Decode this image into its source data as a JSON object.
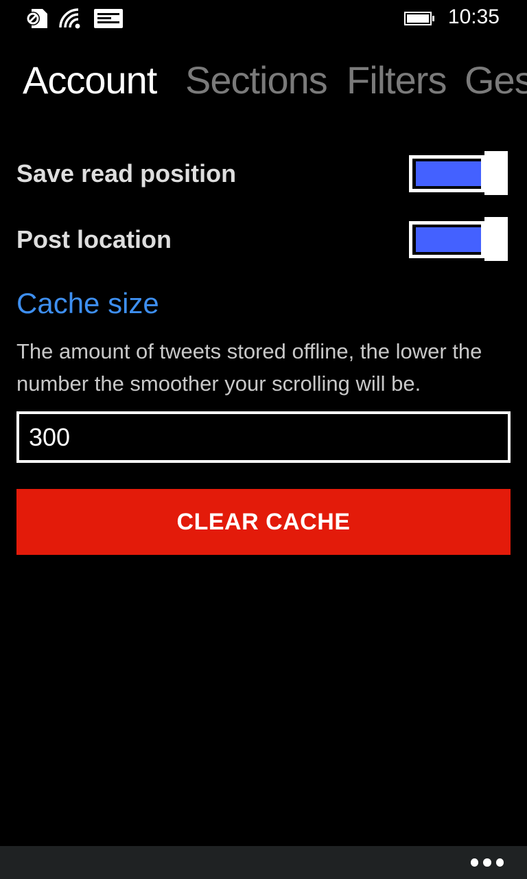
{
  "status_bar": {
    "time": "10:35",
    "icons": [
      "sim-blocked-icon",
      "wifi-icon",
      "notification-icon",
      "battery-icon"
    ]
  },
  "pivot": {
    "tabs": [
      {
        "label": "Account",
        "active": true
      },
      {
        "label": "Sections",
        "active": false
      },
      {
        "label": "Filters",
        "active": false
      },
      {
        "label": "Ges",
        "active": false
      }
    ]
  },
  "settings": {
    "save_read_position": {
      "label": "Save read position",
      "enabled": true
    },
    "post_location": {
      "label": "Post location",
      "enabled": true
    }
  },
  "cache": {
    "title": "Cache size",
    "description": "The amount of tweets stored offline, the lower the number the smoother your scrolling will be.",
    "value": "300",
    "clear_label": "CLEAR CACHE"
  },
  "colors": {
    "accent": "#4461ff",
    "section_title": "#3e8ff0",
    "danger": "#e31b0a",
    "app_bar": "#1f2223"
  },
  "app_bar": {
    "more_icon": "ellipsis-icon"
  }
}
